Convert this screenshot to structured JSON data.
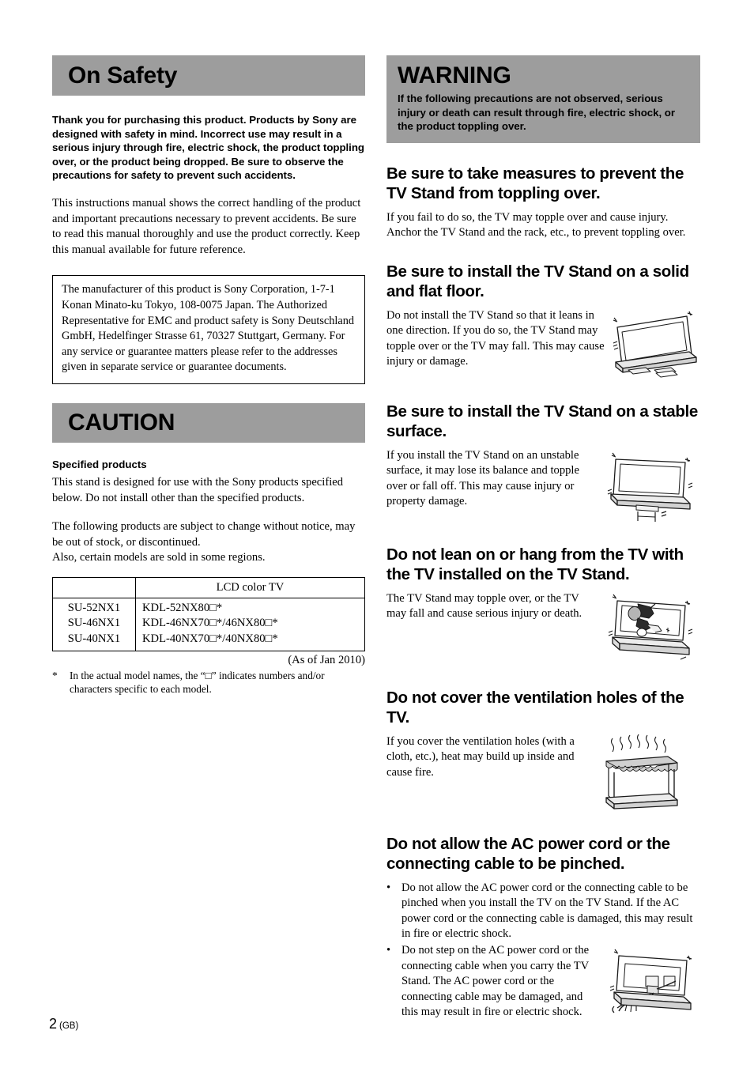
{
  "page": {
    "number": "2",
    "region_code": "(GB)"
  },
  "left_column": {
    "on_safety": {
      "banner_title": "On Safety",
      "intro_bold": "Thank you for purchasing this product. Products by Sony are designed with safety in mind. Incorrect use may result in a serious injury through fire, electric shock, the product toppling over, or the product being dropped. Be sure to observe the precautions for safety to prevent such accidents.",
      "intro_body": "This instructions manual shows the correct handling of the product and important precautions necessary to prevent accidents. Be sure to read this manual thoroughly and use the product correctly. Keep this manual available for future reference.",
      "manufacturer_box": "The manufacturer of this product is Sony Corporation, 1-7-1 Konan Minato-ku Tokyo, 108-0075 Japan. The Authorized Representative for EMC and product safety is Sony Deutschland GmbH, Hedelfinger Strasse 61, 70327 Stuttgart, Germany. For any service or guarantee matters please refer to the addresses given in separate service or guarantee documents."
    },
    "caution": {
      "banner_title": "CAUTION",
      "sub_heading": "Specified products",
      "paragraph_1": "This stand is designed for use with the Sony products specified below. Do not install other than the specified products.",
      "paragraph_2": "The following products are subject to change without notice, may be out of stock, or discontinued.\nAlso, certain models are sold in some regions.",
      "table": {
        "headers": [
          "",
          "LCD color TV"
        ],
        "stand_models": [
          "SU-52NX1",
          "SU-46NX1",
          "SU-40NX1"
        ],
        "tv_models": [
          "KDL-52NX80□*",
          "KDL-46NX70□*/46NX80□*",
          "KDL-40NX70□*/40NX80□*"
        ]
      },
      "as_of": "(As of Jan 2010)",
      "footnote_marker": "*",
      "footnote_text": "In the actual model names, the “□” indicates numbers and/or characters specific to each model."
    }
  },
  "right_column": {
    "warning_banner": {
      "title": "WARNING",
      "subtitle": "If the following precautions are not observed, serious injury or death can result through fire, electric shock, or the product toppling over."
    },
    "sections": [
      {
        "heading": "Be sure to take measures to prevent the TV Stand from toppling over.",
        "body": "If you fail to do so, the TV may topple over and cause injury. Anchor the TV Stand and the rack, etc., to prevent toppling over.",
        "figure": null
      },
      {
        "heading": "Be sure to install the TV Stand on a solid and flat floor.",
        "body": "Do not install the TV Stand so that it leans in one direction. If you do so, the TV Stand may topple over or the TV may fall. This may cause injury or damage.",
        "figure": "tv-tilted-on-stand-illustration"
      },
      {
        "heading": "Be sure to install the TV Stand on a stable surface.",
        "body": "If you install the TV Stand on an unstable surface, it may lose its balance and topple over or fall off. This may cause injury or property damage.",
        "figure": "tv-on-unstable-stool-illustration"
      },
      {
        "heading": "Do not lean on or hang from the TV with the TV installed on the TV Stand.",
        "body": "The TV Stand may topple over, or the TV may fall and cause serious injury or death.",
        "figure": "person-hanging-from-tv-illustration"
      },
      {
        "heading": "Do not cover the ventilation holes of the TV.",
        "body": "If you cover the ventilation holes (with a cloth, etc.), heat may build up inside and cause fire.",
        "figure": "tv-covered-with-cloth-heat-illustration"
      }
    ],
    "cable_section": {
      "heading": "Do not allow the AC power cord or the connecting cable to be pinched.",
      "bullet_marker": "•",
      "bullets": [
        "Do not allow the AC power cord or the connecting cable to be pinched when you install the TV on the TV Stand. If the AC power cord or the connecting cable is damaged, this may result in fire or electric shock.",
        "Do not step on the AC power cord or the connecting cable when you carry the TV Stand. The AC power cord or the connecting cable may be damaged, and this may result in fire or electric shock."
      ],
      "figure": "tv-rear-with-cables-illustration"
    }
  },
  "colors": {
    "banner_gray": "#9d9d9d",
    "text_black": "#000000",
    "page_background": "#ffffff",
    "illustration_fill": "#d9d9d9"
  }
}
